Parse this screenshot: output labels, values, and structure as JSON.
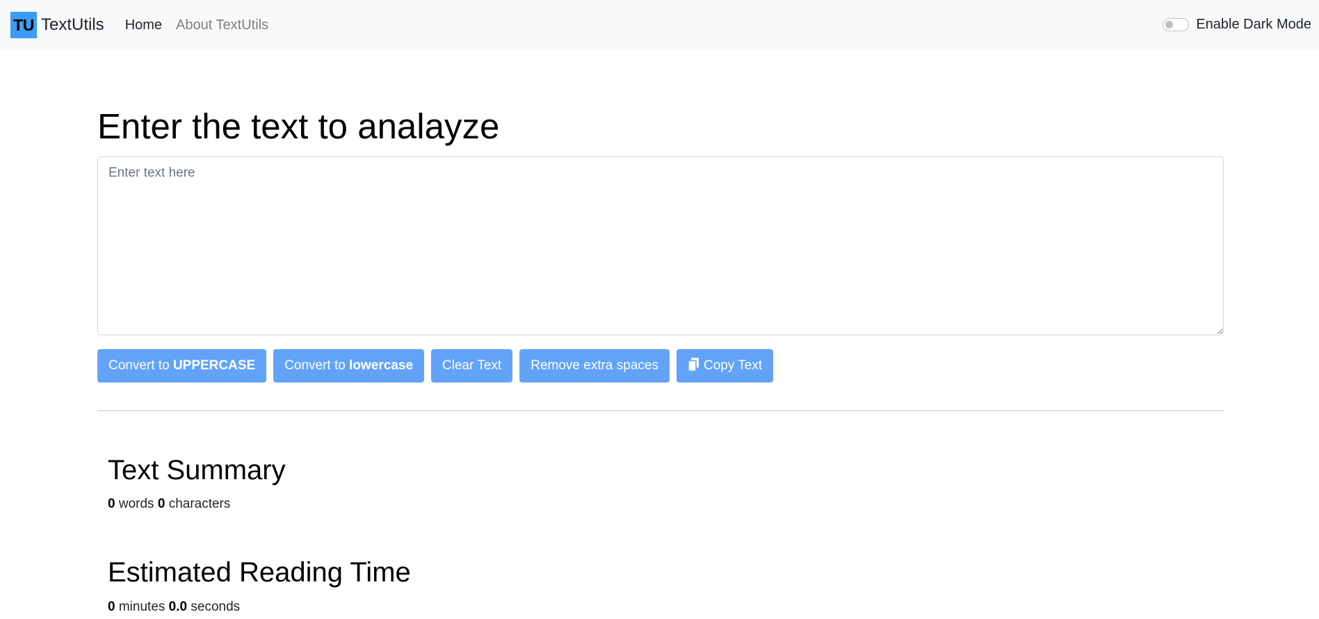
{
  "navbar": {
    "logo_text": "TU",
    "brand": "TextUtils",
    "links": [
      {
        "label": "Home"
      },
      {
        "label": "About TextUtils"
      }
    ],
    "dark_mode_label": "Enable Dark Mode",
    "dark_mode_enabled": false
  },
  "main": {
    "heading": "Enter the text to analayze",
    "textarea": {
      "placeholder": "Enter text here",
      "value": ""
    },
    "buttons": {
      "uppercase": {
        "prefix": "Convert to ",
        "bold": "UPPERCASE"
      },
      "lowercase": {
        "prefix": "Convert to ",
        "bold": "lowercase"
      },
      "clear": "Clear Text",
      "remove_spaces": "Remove extra spaces",
      "copy": "Copy Text",
      "copy_icon": "copy-icon"
    }
  },
  "summary": {
    "title": "Text Summary",
    "word_count": "0",
    "words_label": "words",
    "char_count": "0",
    "chars_label": "characters"
  },
  "reading_time": {
    "title": "Estimated Reading Time",
    "minutes": "0",
    "minutes_label": "minutes",
    "seconds": "0.0",
    "seconds_label": "seconds"
  },
  "colors": {
    "navbar_bg": "#f8f9fa",
    "logo_bg": "#3d9cf5",
    "button_bg": "#62a3f7"
  }
}
